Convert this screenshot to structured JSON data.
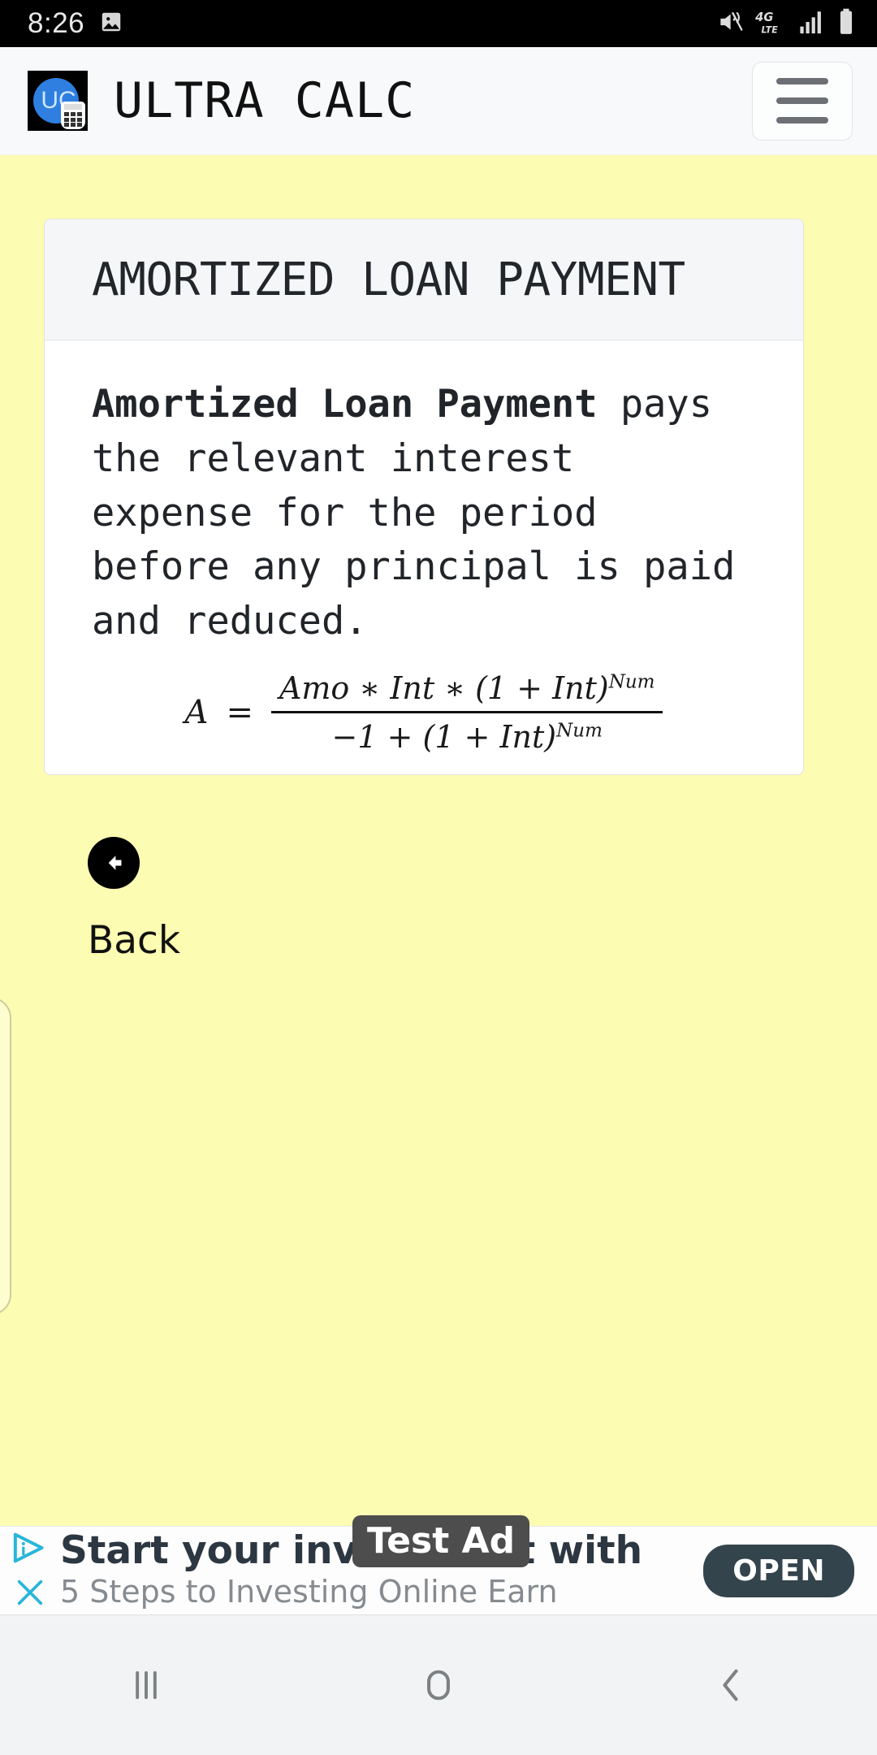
{
  "status_bar": {
    "time": "8:26",
    "icons": [
      "image-icon",
      "mute-icon",
      "4g-lte-icon",
      "signal-bars-icon",
      "battery-icon"
    ],
    "network_label": "4G",
    "network_sub": "LTE"
  },
  "header": {
    "app_title": "ULTRA CALC",
    "logo_text": "UC",
    "menu_icon": "hamburger-menu-icon"
  },
  "card": {
    "title": "AMORTIZED LOAN PAYMENT",
    "body_bold": "Amortized Loan Payment",
    "body_rest": " pays the relevant interest expense for the period before any principal is paid and reduced.",
    "formula": {
      "lhs": "A",
      "equals": "=",
      "numerator": "Amo * Int * (1 + Int)^Num",
      "denominator": "-1 + (1 + Int)^Num",
      "num_parts": {
        "a": "Amo",
        "op1": "∗",
        "b": "Int",
        "op2": "∗",
        "c": "(1 + Int)",
        "exp": "Num"
      },
      "den_parts": {
        "a": "−1 + (1 + Int)",
        "exp": "Num"
      }
    }
  },
  "back": {
    "label": "Back",
    "icon": "arrow-left-circle-icon"
  },
  "ad": {
    "badge": "Test Ad",
    "headline": "Start your investment with",
    "subtext": "5 Steps to Investing Online Earn",
    "cta": "OPEN",
    "adchoices_icon": "adchoices-icon",
    "close_icon": "close-x-icon"
  },
  "navbar": {
    "recents": "recents-icon",
    "home": "home-icon",
    "back": "back-chevron-icon"
  },
  "colors": {
    "page_background": "#fcfcb2",
    "header_background": "#f8f9fa",
    "card_background": "#ffffff",
    "card_header_background": "#f5f6f7",
    "ad_cta": "#34444c",
    "adchoices_accent": "#29b6d8",
    "logo_blue": "#2e7fe0"
  }
}
